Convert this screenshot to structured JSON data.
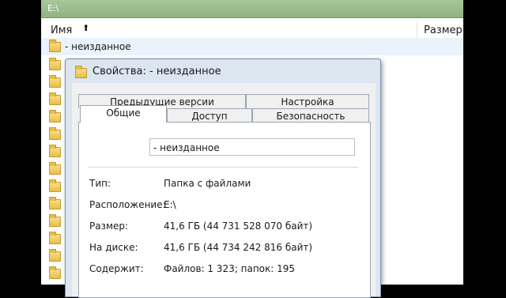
{
  "explorer": {
    "path": "E:\\",
    "columns": {
      "name": "Имя",
      "size": "Размер"
    },
    "selected_item": "- неизданное"
  },
  "dialog": {
    "title": "Свойства: - неизданное",
    "tabs_row1": [
      "Предыдущие версии",
      "Настройка"
    ],
    "tabs_row2": [
      "Общие",
      "Доступ",
      "Безопасность"
    ],
    "active_tab": "Общие",
    "name_value": "- неизданное",
    "properties": [
      {
        "label": "Тип:",
        "value": "Папка с файлами"
      },
      {
        "label": "Расположение:",
        "value": "E:\\"
      },
      {
        "label": "Размер:",
        "value": "41,6 ГБ (44 731 528 070 байт)"
      },
      {
        "label": "На диске:",
        "value": "41,6 ГБ (44 734 242 816 байт)"
      },
      {
        "label": "Содержит:",
        "value": "Файлов: 1 323; папок: 195"
      }
    ]
  }
}
